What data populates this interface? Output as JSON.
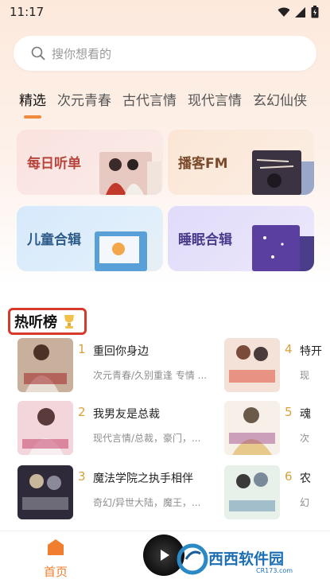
{
  "status": {
    "time": "11:17"
  },
  "search": {
    "placeholder": "搜你想看的"
  },
  "tabs": [
    "精选",
    "次元青春",
    "古代言情",
    "现代言情",
    "玄幻仙侠"
  ],
  "categories": [
    {
      "label": "每日听单",
      "bg": "#fbe3e0",
      "color": "#b8443c"
    },
    {
      "label": "播客FM",
      "bg": "#fbe8d9",
      "color": "#7a4a2a"
    },
    {
      "label": "儿童合辑",
      "bg": "#dcecfa",
      "color": "#2c5a88"
    },
    {
      "label": "睡眠合辑",
      "bg": "#e4e0fb",
      "color": "#4a3a8c"
    }
  ],
  "section": {
    "title": "热听榜"
  },
  "rankings_left": [
    {
      "num": "1",
      "title": "重回你身边",
      "tags": "次元青春/久别重逢 专情 ..."
    },
    {
      "num": "2",
      "title": "我男友是总裁",
      "tags": "现代言情/总裁，豪门，..."
    },
    {
      "num": "3",
      "title": "魔法学院之执手相伴",
      "tags": "奇幻/异世大陆，魔王，..."
    }
  ],
  "rankings_right": [
    {
      "num": "4",
      "title": "特开",
      "tags": "现"
    },
    {
      "num": "5",
      "title": "魂",
      "tags": "次"
    },
    {
      "num": "6",
      "title": "农",
      "tags": "幻"
    }
  ],
  "bottom_nav": {
    "home_label": "首页"
  },
  "watermark": {
    "text": "西西软件园",
    "url": "CR173.com"
  }
}
